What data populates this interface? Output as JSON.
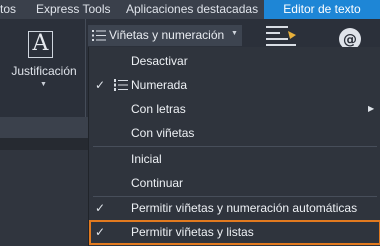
{
  "tabs": [
    {
      "label": "tos",
      "active": false
    },
    {
      "label": "Express Tools",
      "active": false
    },
    {
      "label": "Aplicaciones destacadas",
      "active": false
    },
    {
      "label": "Editor de texto",
      "active": true
    }
  ],
  "ribbon": {
    "justification_label": "Justificación",
    "bullets_button_label": "Viñetas y numeración"
  },
  "menu": {
    "items": [
      {
        "label": "Desactivar",
        "checked": false,
        "has_submenu": false
      },
      {
        "label": "Numerada",
        "checked": true,
        "has_submenu": false
      },
      {
        "label": "Con letras",
        "checked": false,
        "has_submenu": true
      },
      {
        "label": "Con viñetas",
        "checked": false,
        "has_submenu": false
      },
      {
        "label": "Inicial",
        "checked": false,
        "has_submenu": false
      },
      {
        "label": "Continuar",
        "checked": false,
        "has_submenu": false
      },
      {
        "label": "Permitir viñetas y numeración automáticas",
        "checked": true,
        "has_submenu": false
      },
      {
        "label": "Permitir viñetas y listas",
        "checked": true,
        "has_submenu": false,
        "highlighted": true
      }
    ],
    "check_glyph": "✓",
    "submenu_glyph": "▶"
  },
  "colors": {
    "active_tab": "#1e86d6",
    "highlight_border": "#e27a1f",
    "menu_bg": "#2f343d"
  }
}
